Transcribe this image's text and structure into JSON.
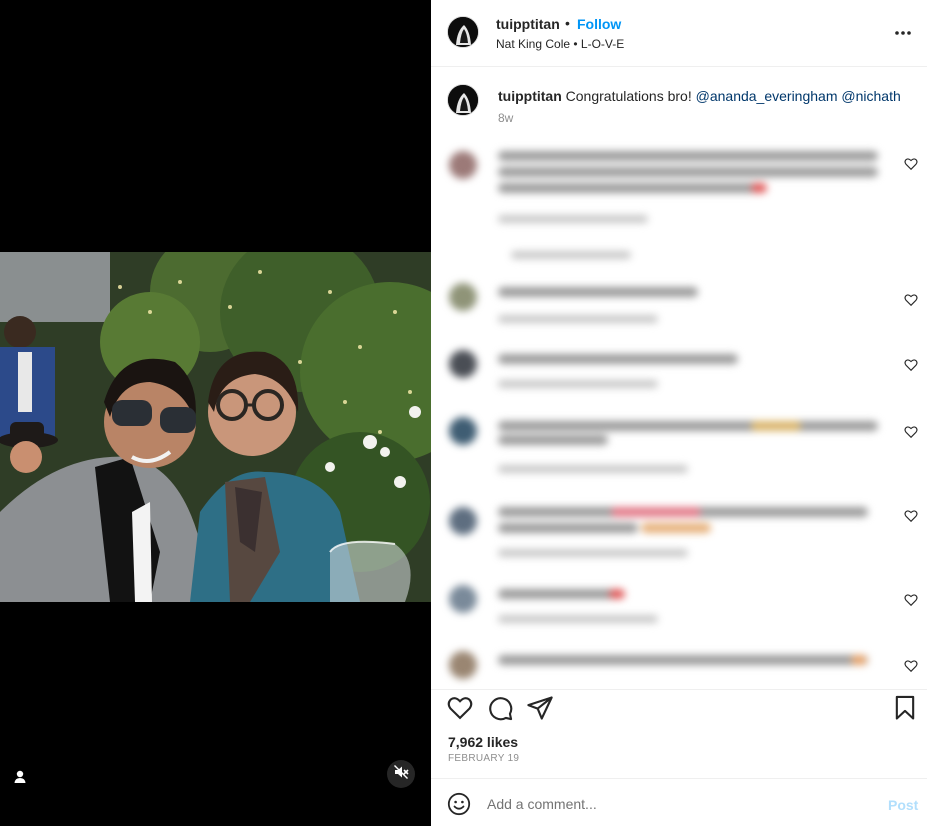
{
  "post": {
    "username": "tuipptitan",
    "separator": "•",
    "follow_label": "Follow",
    "audio": "Nat King Cole • L-O-V-E",
    "more_icon": "more-horizontal-icon"
  },
  "caption": {
    "username": "tuipptitan",
    "text": "Congratulations bro!",
    "mentions": [
      "@ananda_everingham",
      "@nichath"
    ],
    "time": "8w"
  },
  "comments": {
    "blurred": true,
    "count_visible": 8
  },
  "actions": {
    "like_icon": "heart-icon",
    "comment_icon": "comment-icon",
    "share_icon": "send-icon",
    "save_icon": "bookmark-icon"
  },
  "likes": "7,962 likes",
  "date": "FEBRUARY 19",
  "add_comment": {
    "placeholder": "Add a comment...",
    "post_label": "Post",
    "emoji_icon": "emoji-icon"
  },
  "media": {
    "muted": true,
    "user_tag_icon": "user-tag-icon",
    "mute_icon": "speaker-muted-icon"
  },
  "colors": {
    "accent": "#0095f6",
    "mention": "#00376b",
    "post_disabled": "#b2dffc",
    "muted_text": "#8e8e8e"
  }
}
